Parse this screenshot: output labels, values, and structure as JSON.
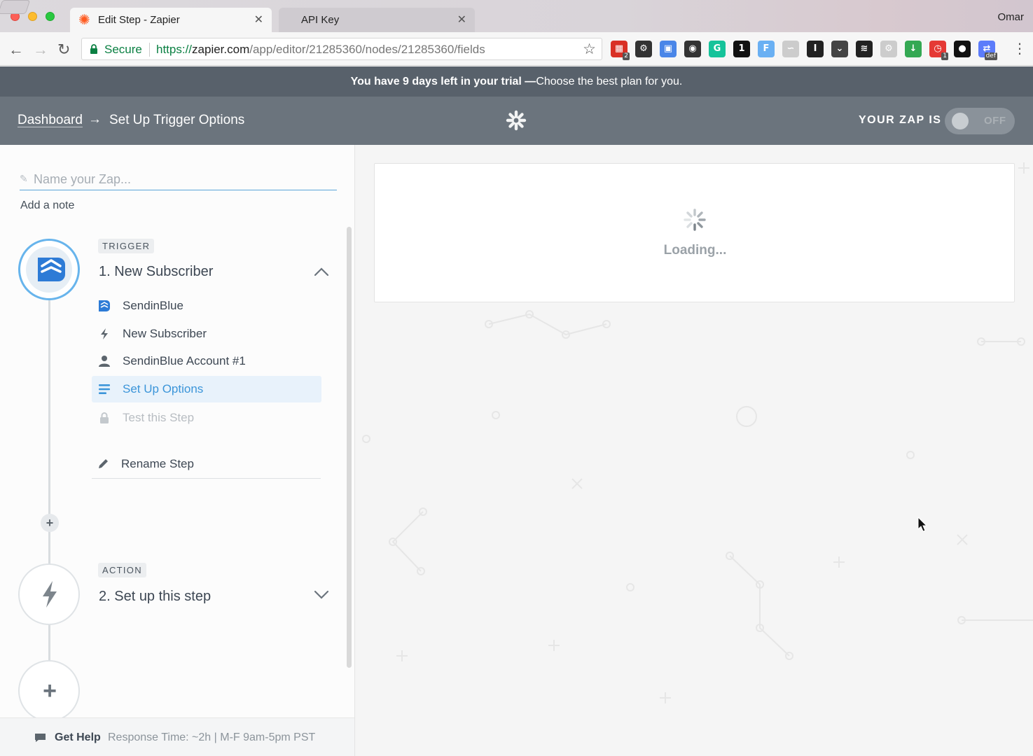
{
  "browser": {
    "tabs": [
      {
        "title": "Edit Step - Zapier",
        "active": true,
        "favicon": "zapier-asterisk-icon"
      },
      {
        "title": "API Key",
        "active": false
      }
    ],
    "profile_name": "Omar",
    "security_label": "Secure",
    "url": {
      "scheme": "https://",
      "host": "zapier.com",
      "path": "/app/editor/21285360/nodes/21285360/fields"
    },
    "extensions": [
      {
        "icon": "calendar-icon",
        "badge": "2",
        "color": "#d93025"
      },
      {
        "icon": "gear-icon",
        "color": "#333333"
      },
      {
        "icon": "window-icon",
        "color": "#4a86e8"
      },
      {
        "icon": "camera-icon",
        "color": "#333333"
      },
      {
        "icon": "grammarly-icon",
        "color": "#15c39a"
      },
      {
        "icon": "onepassword-icon",
        "color": "#111111"
      },
      {
        "icon": "font-icon",
        "color": "#6ab0f3"
      },
      {
        "icon": "swirl-icon",
        "color": "#cccccc"
      },
      {
        "icon": "instapaper-icon",
        "color": "#222222"
      },
      {
        "icon": "pocket-icon",
        "color": "#444444"
      },
      {
        "icon": "buffer-icon",
        "color": "#222222"
      },
      {
        "icon": "cog-light-icon",
        "color": "#cccccc"
      },
      {
        "icon": "download-icon",
        "color": "#34a853"
      },
      {
        "icon": "stopwatch-icon",
        "badge": "1",
        "color": "#e53935"
      },
      {
        "icon": "ninja-icon",
        "color": "#111111"
      },
      {
        "icon": "define-icon",
        "badge": "def",
        "color": "#5c7cfa"
      }
    ]
  },
  "trial_banner": {
    "strong": "You have 9 days left in your trial —",
    "link": "Choose the best plan for you."
  },
  "header": {
    "breadcrumb_root": "Dashboard",
    "breadcrumb_arrow": "→",
    "breadcrumb_current": "Set Up Trigger Options",
    "zap_status_label": "YOUR ZAP IS",
    "zap_toggle_state": "OFF"
  },
  "sidebar": {
    "name_placeholder": "Name your Zap...",
    "name_value": "",
    "add_note": "Add a note",
    "trigger": {
      "badge": "TRIGGER",
      "title": "1. New Subscriber",
      "app_color": "#2d7bd6",
      "items": [
        {
          "icon": "sendinblue-icon",
          "label": "SendinBlue",
          "state": "normal"
        },
        {
          "icon": "bolt-icon",
          "label": "New Subscriber",
          "state": "normal"
        },
        {
          "icon": "user-icon",
          "label": "SendinBlue Account #1",
          "state": "normal"
        },
        {
          "icon": "list-icon",
          "label": "Set Up Options",
          "state": "active"
        },
        {
          "icon": "lock-icon",
          "label": "Test this Step",
          "state": "disabled"
        }
      ],
      "rename": "Rename Step"
    },
    "action": {
      "badge": "ACTION",
      "title": "2. Set up this step"
    },
    "help": {
      "label": "Get Help",
      "info": "Response Time: ~2h | M-F 9am-5pm PST"
    }
  },
  "main": {
    "loading_text": "Loading..."
  }
}
